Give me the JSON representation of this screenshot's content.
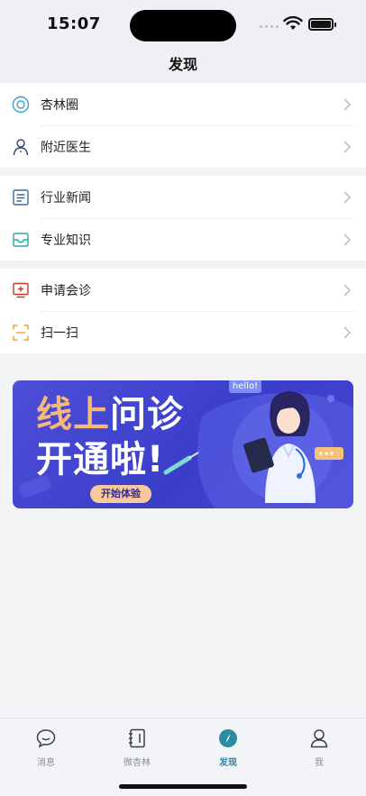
{
  "status": {
    "time": "15:07"
  },
  "nav": {
    "title": "发现"
  },
  "groups": [
    {
      "items": [
        {
          "label": "杏林圈",
          "icon": "target-circle-icon"
        },
        {
          "label": "附近医生",
          "icon": "person-icon"
        }
      ]
    },
    {
      "items": [
        {
          "label": "行业新闻",
          "icon": "news-icon"
        },
        {
          "label": "专业知识",
          "icon": "inbox-tray-icon"
        }
      ]
    },
    {
      "items": [
        {
          "label": "申请会诊",
          "icon": "monitor-plus-icon"
        },
        {
          "label": "扫一扫",
          "icon": "scan-frame-icon"
        }
      ]
    }
  ],
  "banner": {
    "line1_a": "线上",
    "line1_b": "问诊",
    "line2": "开通啦!",
    "cta": "开始体验",
    "hello": "hello!"
  },
  "tabs": [
    {
      "label": "消息",
      "icon": "chat-bubble-icon",
      "active": false
    },
    {
      "label": "微杏林",
      "icon": "notebook-icon",
      "active": false
    },
    {
      "label": "发现",
      "icon": "compass-icon",
      "active": true
    },
    {
      "label": "我",
      "icon": "user-icon",
      "active": false
    }
  ],
  "colors": {
    "accent": "#2a8ca0",
    "banner_bg": "#4345d0",
    "banner_highlight": "#f6b97a"
  }
}
